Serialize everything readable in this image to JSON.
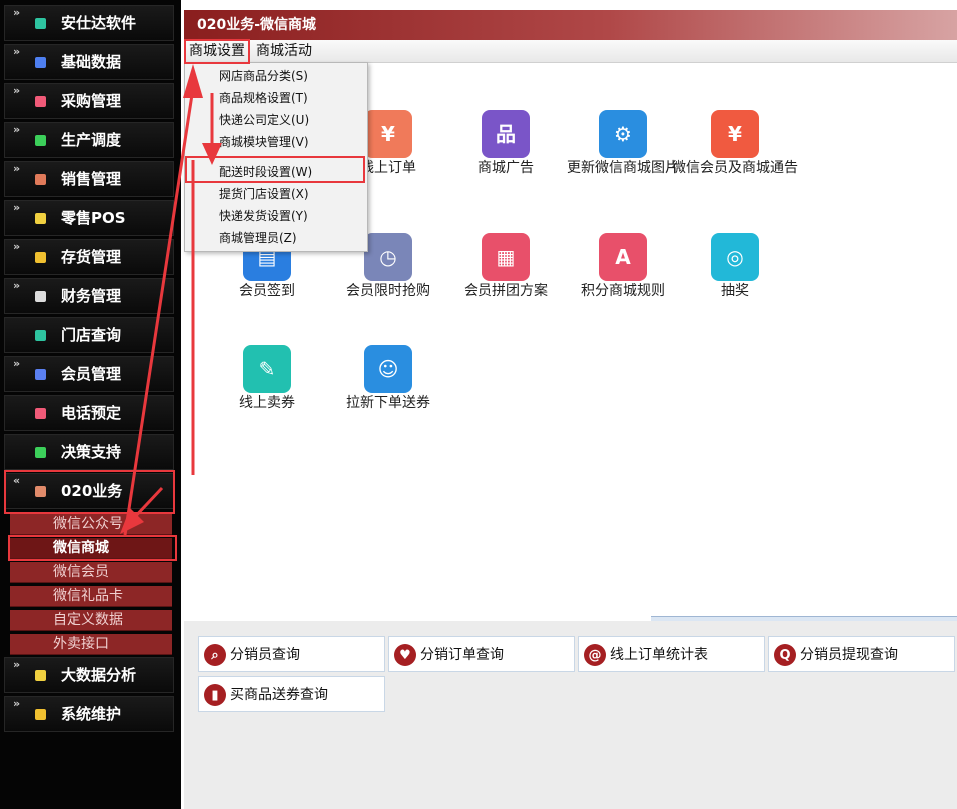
{
  "sidebar": {
    "items": [
      {
        "label": "安仕达软件",
        "color": "#2ec4a0"
      },
      {
        "label": "基础数据",
        "color": "#4e7ff0"
      },
      {
        "label": "采购管理",
        "color": "#f05a78"
      },
      {
        "label": "生产调度",
        "color": "#3ccf5a"
      },
      {
        "label": "销售管理",
        "color": "#e07a5a"
      },
      {
        "label": "零售POS",
        "color": "#f0d040"
      },
      {
        "label": "存货管理",
        "color": "#f0c030"
      },
      {
        "label": "财务管理",
        "color": "#dddddd"
      },
      {
        "label": "门店查询",
        "color": "#2ec4a0"
      },
      {
        "label": "会员管理",
        "color": "#5a7ff0"
      },
      {
        "label": "电话预定",
        "color": "#f05a78"
      },
      {
        "label": "决策支持",
        "color": "#3ccf5a"
      },
      {
        "label": "020业务",
        "color": "#e08a6a"
      },
      {
        "label": "大数据分析",
        "color": "#f0d040"
      },
      {
        "label": "系统维护",
        "color": "#f0c030"
      }
    ],
    "sub_items": [
      "微信公众号",
      "微信商城",
      "微信会员",
      "微信礼品卡",
      "自定义数据",
      "外卖接口"
    ]
  },
  "title": "020业务-微信商城",
  "menu": {
    "items": [
      "商城设置",
      "商城活动"
    ]
  },
  "dropdown": {
    "items": [
      "网店商品分类(S)",
      "商品规格设置(T)",
      "快递公司定义(U)",
      "商城模块管理(V)",
      "配送时段设置(W)",
      "提货门店设置(X)",
      "快递发货设置(Y)",
      "商城管理员(Z)"
    ]
  },
  "apps": [
    {
      "label": "线上订单",
      "color": "#f07a5a",
      "icon": "yuan-cycle-icon",
      "glyph": "¥"
    },
    {
      "label": "商城广告",
      "color": "#7a55c8",
      "icon": "org-chart-icon",
      "glyph": "品"
    },
    {
      "label": "更新微信商城图片",
      "color": "#2a8ee0",
      "icon": "monitor-gear-icon",
      "glyph": "⚙"
    },
    {
      "label": "微信会员及商城通告",
      "color": "#f05a40",
      "icon": "ledger-yuan-icon",
      "glyph": "¥"
    },
    {
      "label": "会员签到",
      "color": "#2a7ee0",
      "icon": "id-card-icon",
      "glyph": "▤"
    },
    {
      "label": "会员限时抢购",
      "color": "#7a86b8",
      "icon": "clock-window-icon",
      "glyph": "◷"
    },
    {
      "label": "会员拼团方案",
      "color": "#e8506a",
      "icon": "doc-user-icon",
      "glyph": "▦"
    },
    {
      "label": "积分商城规则",
      "color": "#e8506a",
      "icon": "abc-rules-icon",
      "glyph": "A"
    },
    {
      "label": "抽奖",
      "color": "#22b8d8",
      "icon": "search-chart-icon",
      "glyph": "◎"
    },
    {
      "label": "线上卖券",
      "color": "#22c0b0",
      "icon": "checklist-icon",
      "glyph": "✎"
    },
    {
      "label": "拉新下单送券",
      "color": "#2a8ee0",
      "icon": "users-icon",
      "glyph": "☺"
    }
  ],
  "quick": [
    {
      "label": "分销员查询",
      "icon": "search-card-icon",
      "glyph": "⌕"
    },
    {
      "label": "分销订单查询",
      "icon": "heart-icon",
      "glyph": "♥"
    },
    {
      "label": "线上订单统计表",
      "icon": "stats-doc-icon",
      "glyph": "@"
    },
    {
      "label": "分销员提现查询",
      "icon": "magnifier-icon",
      "glyph": "Q"
    },
    {
      "label": "买商品送券查询",
      "icon": "bar-chart-icon",
      "glyph": "▮"
    }
  ]
}
